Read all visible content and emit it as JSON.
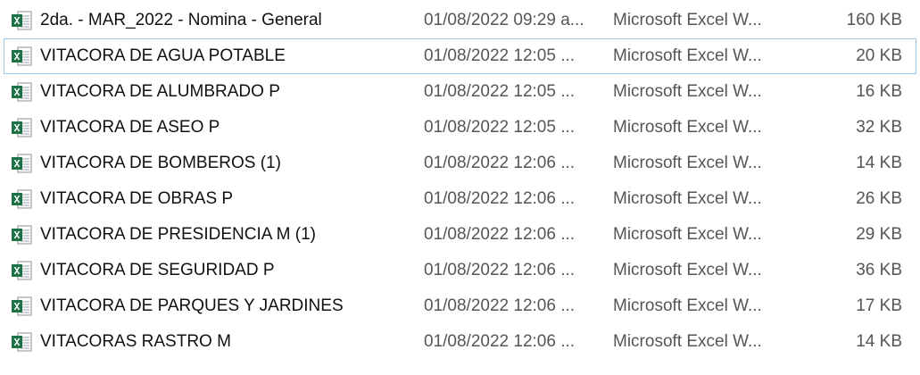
{
  "colors": {
    "focus_border": "#99c9ef",
    "excel_green": "#1e7145",
    "secondary_text": "#555555"
  },
  "icons": {
    "file_type": "excel-file-icon"
  },
  "files": [
    {
      "name": "2da. - MAR_2022 - Nomina - General",
      "date": "01/08/2022 09:29 a...",
      "type": "Microsoft Excel W...",
      "size": "160 KB"
    },
    {
      "name": "VITACORA DE  AGUA POTABLE",
      "date": "01/08/2022 12:05 ...",
      "type": "Microsoft Excel W...",
      "size": "20 KB"
    },
    {
      "name": "VITACORA DE  ALUMBRADO P",
      "date": "01/08/2022 12:05 ...",
      "type": "Microsoft Excel W...",
      "size": "16 KB"
    },
    {
      "name": "VITACORA DE  ASEO P",
      "date": "01/08/2022 12:05 ...",
      "type": "Microsoft Excel W...",
      "size": "32 KB"
    },
    {
      "name": "VITACORA DE  BOMBEROS (1)",
      "date": "01/08/2022 12:06 ...",
      "type": "Microsoft Excel W...",
      "size": "14 KB"
    },
    {
      "name": "VITACORA DE  OBRAS P",
      "date": "01/08/2022 12:06 ...",
      "type": "Microsoft Excel W...",
      "size": "26 KB"
    },
    {
      "name": "VITACORA DE  PRESIDENCIA M (1)",
      "date": "01/08/2022 12:06 ...",
      "type": "Microsoft Excel W...",
      "size": "29 KB"
    },
    {
      "name": "VITACORA DE  SEGURIDAD P",
      "date": "01/08/2022 12:06 ...",
      "type": "Microsoft Excel W...",
      "size": "36 KB"
    },
    {
      "name": "VITACORA DE PARQUES Y JARDINES",
      "date": "01/08/2022 12:06 ...",
      "type": "Microsoft Excel W...",
      "size": "17 KB"
    },
    {
      "name": "VITACORAS RASTRO M",
      "date": "01/08/2022 12:06 ...",
      "type": "Microsoft Excel W...",
      "size": "14 KB"
    }
  ]
}
